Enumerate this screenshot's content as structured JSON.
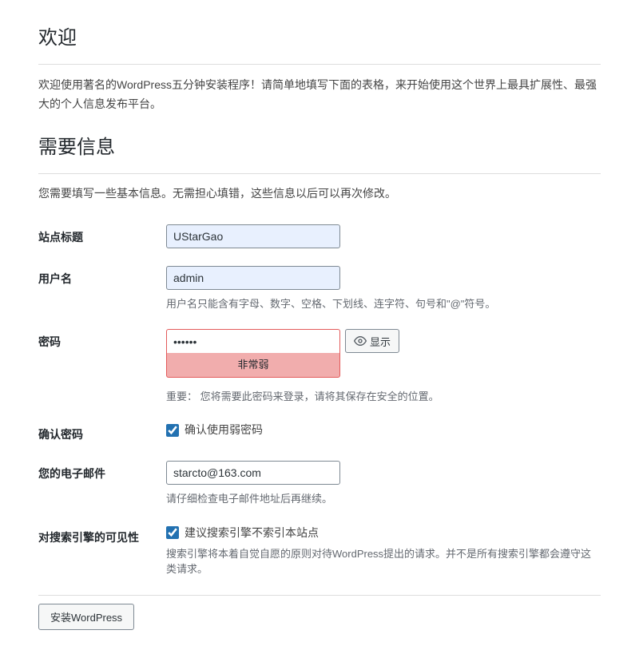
{
  "heading1": "欢迎",
  "intro": "欢迎使用著名的WordPress五分钟安装程序！请简单地填写下面的表格，来开始使用这个世界上最具扩展性、最强大的个人信息发布平台。",
  "heading2": "需要信息",
  "desc": "您需要填写一些基本信息。无需担心填错，这些信息以后可以再次修改。",
  "site_title": {
    "label": "站点标题",
    "value": "UStarGao"
  },
  "username": {
    "label": "用户名",
    "value": "admin",
    "hint": "用户名只能含有字母、数字、空格、下划线、连字符、句号和\"@\"符号。"
  },
  "password": {
    "label": "密码",
    "value": "••••••",
    "strength": "非常弱",
    "show_btn": "显示",
    "important": "重要： 您将需要此密码来登录，请将其保存在安全的位置。"
  },
  "confirm_pw": {
    "label": "确认密码",
    "checkbox_label": "确认使用弱密码"
  },
  "email": {
    "label": "您的电子邮件",
    "value": "starcto@163.com",
    "hint": "请仔细检查电子邮件地址后再继续。"
  },
  "search_vis": {
    "label": "对搜索引擎的可见性",
    "checkbox_label": "建议搜索引擎不索引本站点",
    "hint": "搜索引擎将本着自觉自愿的原则对待WordPress提出的请求。并不是所有搜索引擎都会遵守这类请求。"
  },
  "submit": "安装WordPress"
}
